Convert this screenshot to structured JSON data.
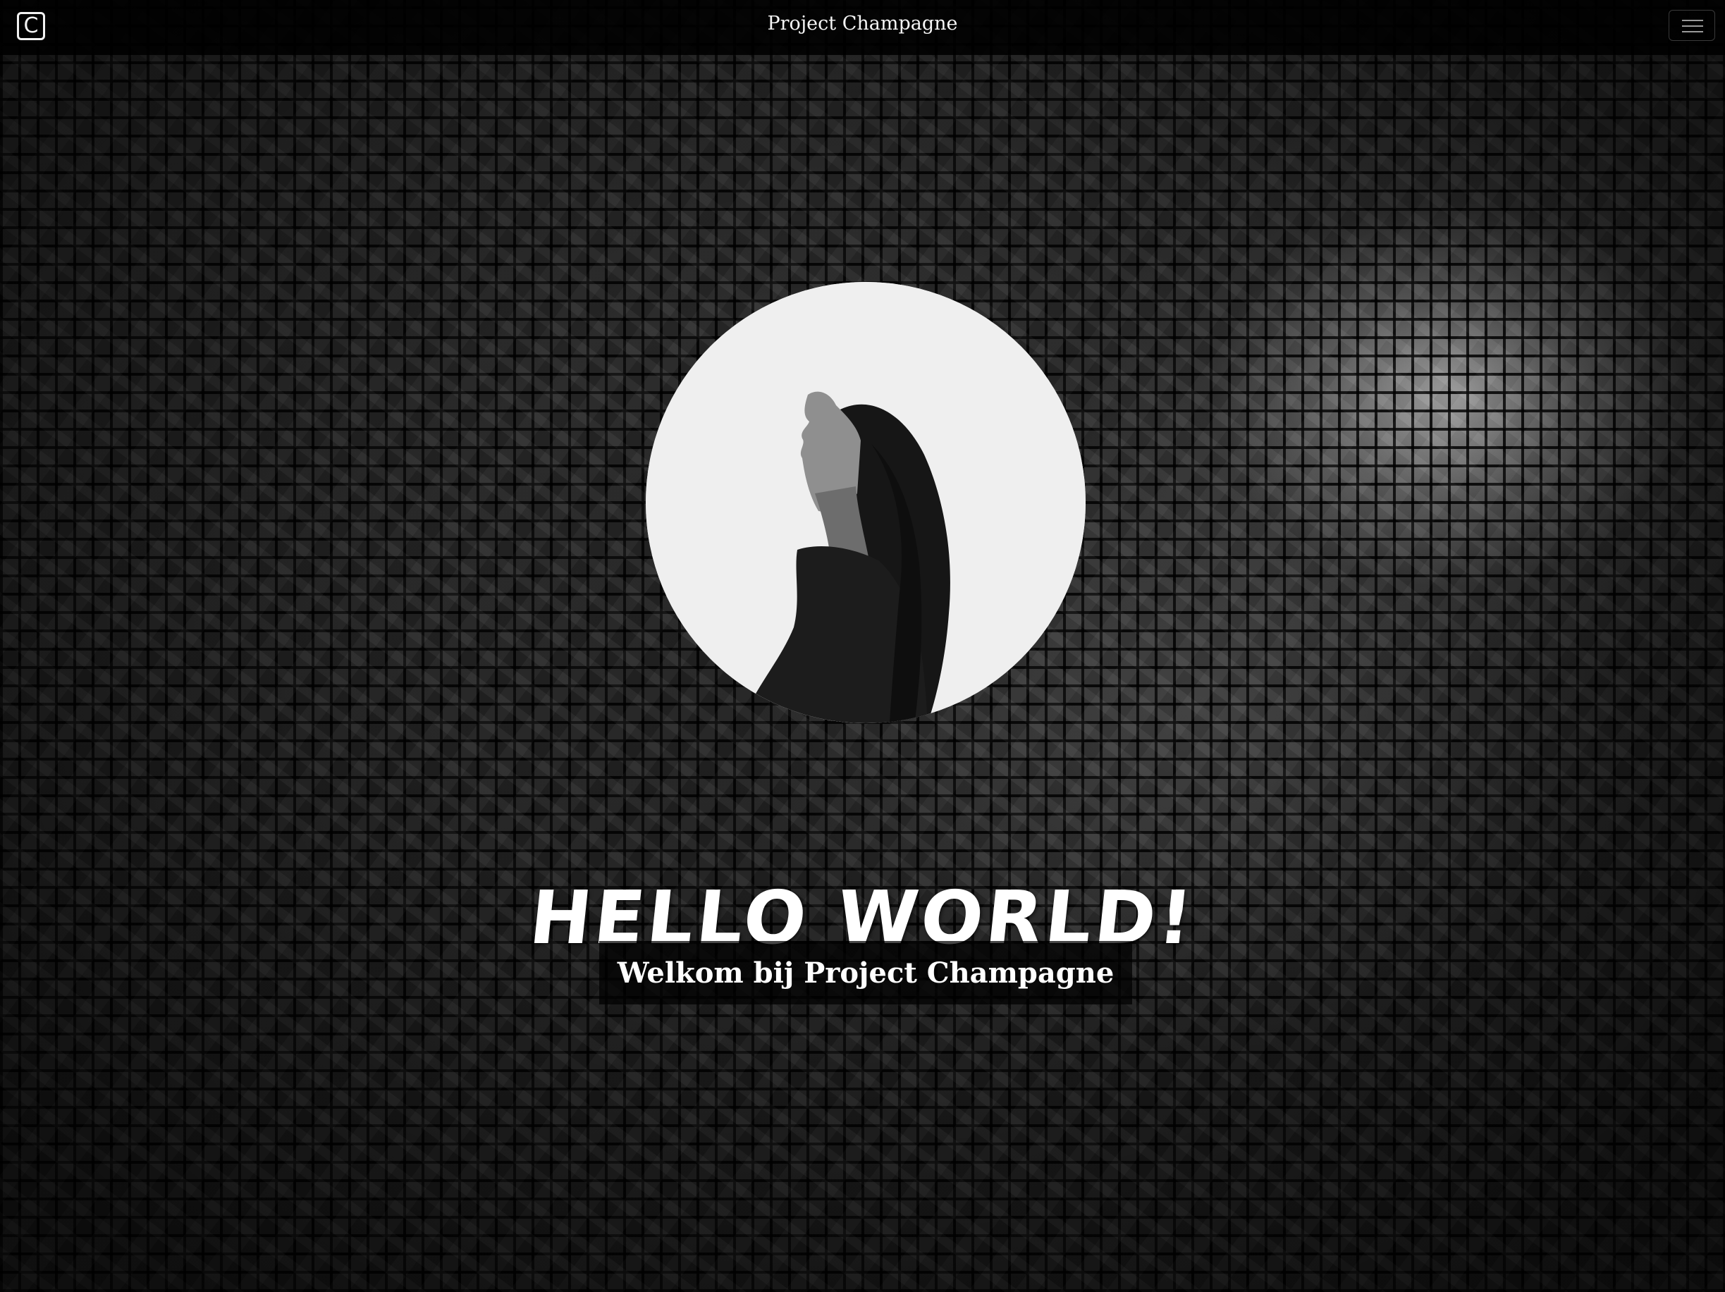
{
  "navbar": {
    "brand_letter": "C",
    "title": "Project Champagne",
    "menu_icon": "hamburger-icon"
  },
  "hero": {
    "headline": "HELLO WORLD!",
    "subtitle": "Welkom bij Project Champagne"
  },
  "colors": {
    "navbar_bg": "#000000",
    "text": "#ffffff",
    "portrait_bg": "#efefef"
  }
}
